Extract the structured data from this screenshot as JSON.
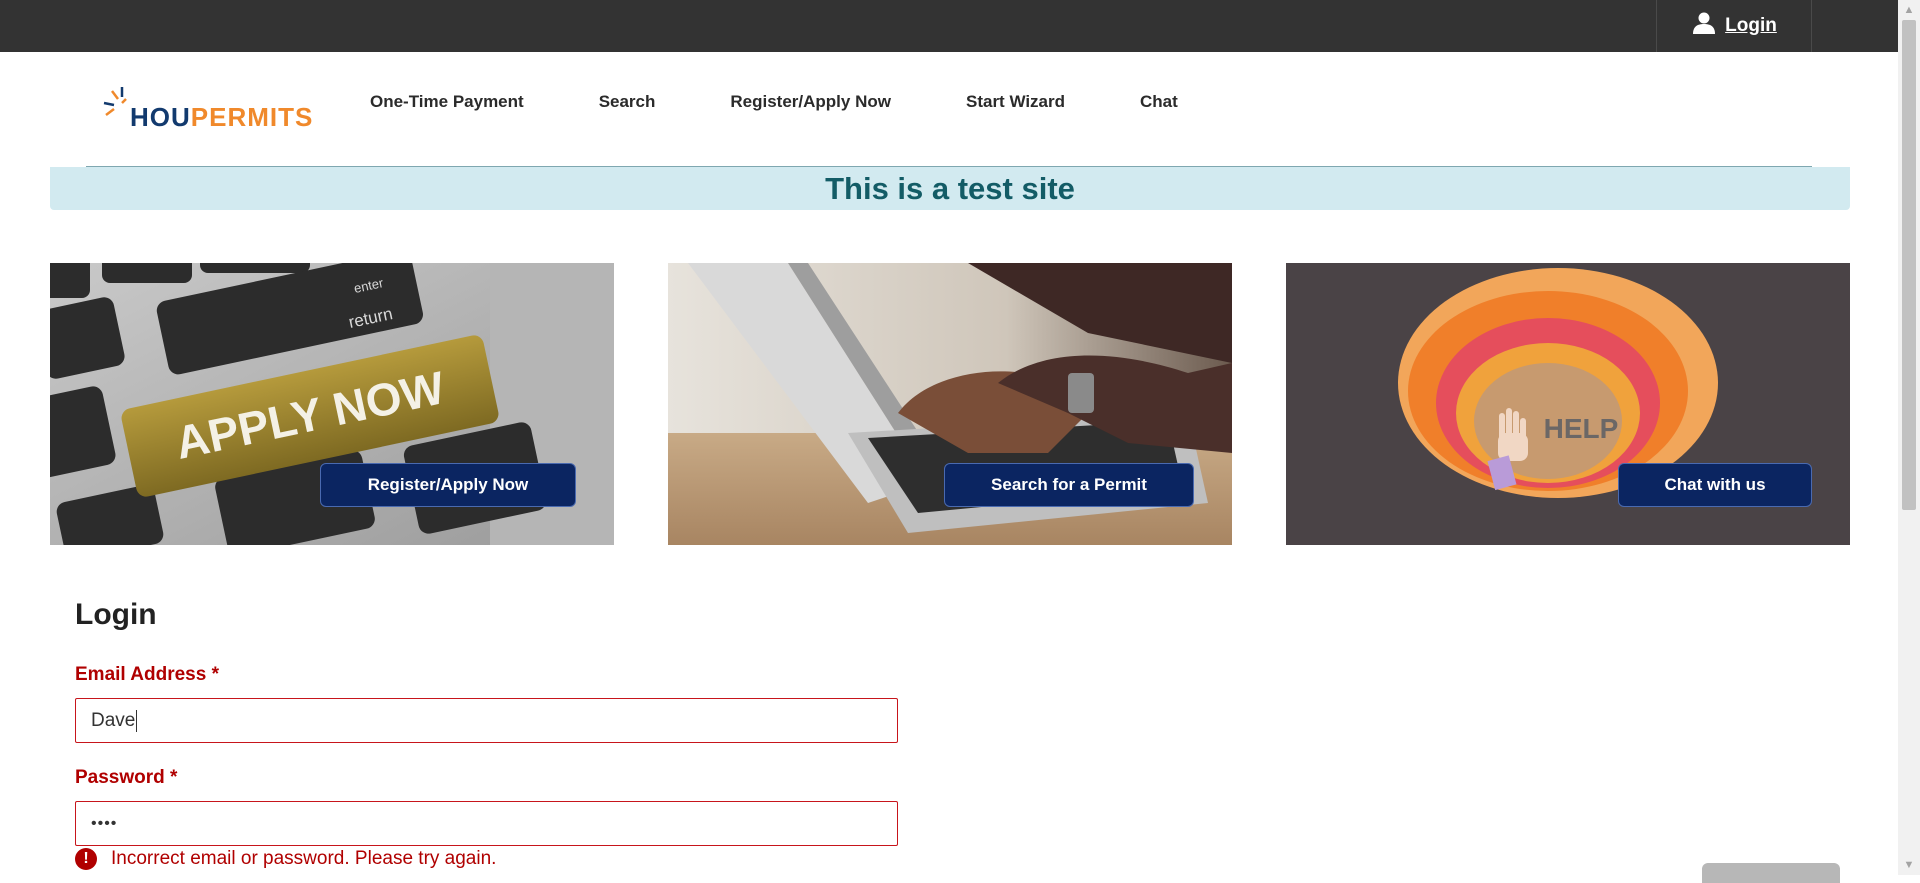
{
  "topbar": {
    "login_label": "Login",
    "user_icon": "user-icon"
  },
  "logo": {
    "part1": "HOU",
    "part2": "PERMITS"
  },
  "nav": {
    "items": [
      "One-Time Payment",
      "Search",
      "Register/Apply Now",
      "Start Wizard",
      "Chat"
    ]
  },
  "banner": {
    "text": "This is a test site"
  },
  "cards": [
    {
      "image_text": "APPLY NOW",
      "button_label": "Register/Apply Now"
    },
    {
      "button_label": "Search for a Permit"
    },
    {
      "image_text": "HELP",
      "button_label": "Chat with us"
    }
  ],
  "login": {
    "title": "Login",
    "email_label": "Email Address",
    "email_value": "Dave",
    "password_label": "Password",
    "password_value": "••••",
    "required_mark": "*",
    "error_text": "Incorrect email or password. Please try again.",
    "error_icon": "exclamation-icon"
  },
  "colors": {
    "topbar": "#333333",
    "accent_navy": "#0b2561",
    "error_red": "#b00000",
    "banner_bg": "#d2eaf0",
    "banner_text": "#135c66",
    "logo_blue": "#123a6e",
    "logo_orange": "#f0892b"
  }
}
